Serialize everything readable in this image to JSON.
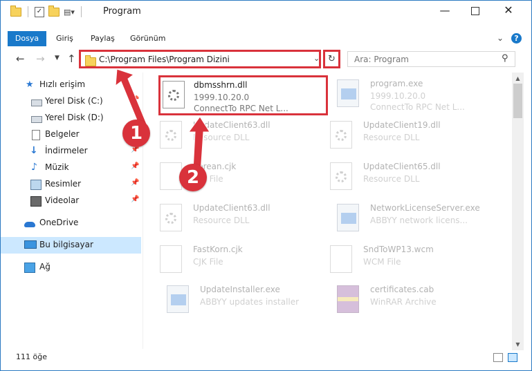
{
  "window": {
    "title": "Program",
    "minimize": "—",
    "maximize": "☐",
    "close": "✕"
  },
  "ribbon": {
    "tabs": [
      "Dosya",
      "Giriş",
      "Paylaş",
      "Görünüm"
    ],
    "help": "?"
  },
  "address": {
    "path": "C:\\Program Files\\Program Dizini",
    "search_placeholder": "Ara: Program"
  },
  "nav_pane": {
    "quick_access": "Hızlı erişim",
    "items": [
      "Yerel Disk (C:)",
      "Yerel Disk (D:)",
      "Belgeler",
      "İndirmeler",
      "Müzik",
      "Resimler",
      "Videolar"
    ],
    "onedrive": "OneDrive",
    "this_pc": "Bu bilgisayar",
    "network": "Ağ"
  },
  "files": [
    {
      "name": "dbmsshrn.dll",
      "line1": "1999.10.20.0",
      "line2": "ConnectTo RPC Net L...",
      "icon": "dll-gear-icon",
      "highlighted": true
    },
    {
      "name": "program.exe",
      "line1": "1999.10.20.0",
      "line2": "ConnectTo RPC Net L...",
      "icon": "exe-icon"
    },
    {
      "name": "UpdateClient63.dll",
      "line1": "Resource DLL",
      "line2": "",
      "icon": "dll-gear-icon"
    },
    {
      "name": "UpdateClient19.dll",
      "line1": "Resource DLL",
      "line2": "",
      "icon": "dll-gear-icon"
    },
    {
      "name": "Korean.cjk",
      "line1": "CJK File",
      "line2": "",
      "icon": "blank-file-icon"
    },
    {
      "name": "UpdateClient65.dll",
      "line1": "Resource DLL",
      "line2": "",
      "icon": "dll-gear-icon"
    },
    {
      "name": "UpdateClient63.dll",
      "line1": "Resource DLL",
      "line2": "",
      "icon": "dll-gear-icon"
    },
    {
      "name": "NetworkLicenseServer.exe",
      "line1": "ABBYY network licens...",
      "line2": "",
      "icon": "exe-icon"
    },
    {
      "name": "FastKorn.cjk",
      "line1": "CJK File",
      "line2": "",
      "icon": "blank-file-icon"
    },
    {
      "name": "SndToWP13.wcm",
      "line1": "WCM File",
      "line2": "",
      "icon": "blank-file-icon"
    },
    {
      "name": "UpdateInstaller.exe",
      "line1": "ABBYY updates installer",
      "line2": "",
      "icon": "exe-icon"
    },
    {
      "name": "certificates.cab",
      "line1": "WinRAR Archive",
      "line2": "",
      "icon": "archive-icon"
    }
  ],
  "status": {
    "count": "111 öğe"
  },
  "annotations": [
    "1",
    "2"
  ],
  "colors": {
    "accent": "#1979ca",
    "highlight_border": "#d9323b",
    "selection": "#cce8ff"
  }
}
